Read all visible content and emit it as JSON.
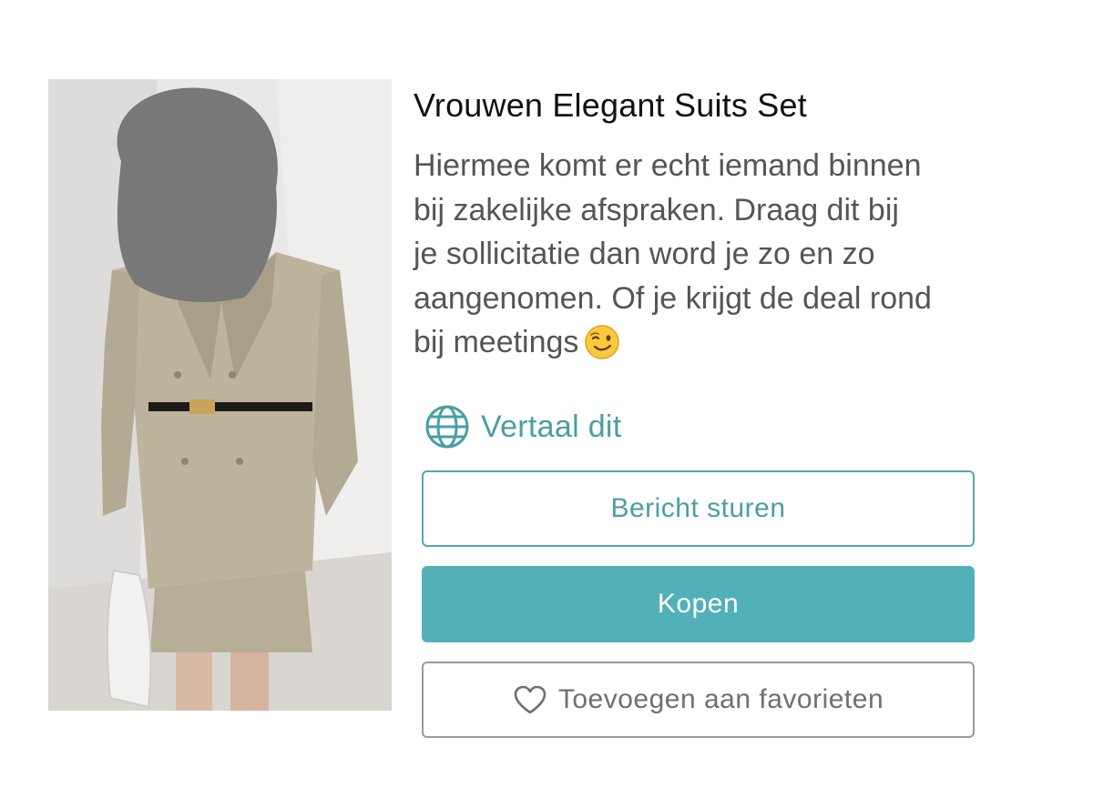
{
  "product": {
    "title": "Vrouwen Elegant Suits Set",
    "description_lines": [
      "Hiermee komt er echt iemand binnen",
      "bij zakelijke afspraken. Draag dit bij",
      "je sollicitatie dan word je zo en zo",
      "aangenomen. Of je krijgt de deal rond",
      "bij meetings"
    ],
    "description_emoji": "winking-face",
    "image": "woman-in-beige-suit-photo"
  },
  "actions": {
    "translate_label": "Vertaal dit",
    "message_label": "Bericht sturen",
    "buy_label": "Kopen",
    "favorite_label": "Toevoegen aan favorieten"
  },
  "icons": {
    "translate": "globe-icon",
    "favorite": "heart-outline-icon"
  },
  "colors": {
    "accent": "#52b0b9",
    "accent_text": "#4a9ea5",
    "title": "#111111",
    "body_text": "#555555",
    "neutral_border": "#9a9a9a"
  }
}
